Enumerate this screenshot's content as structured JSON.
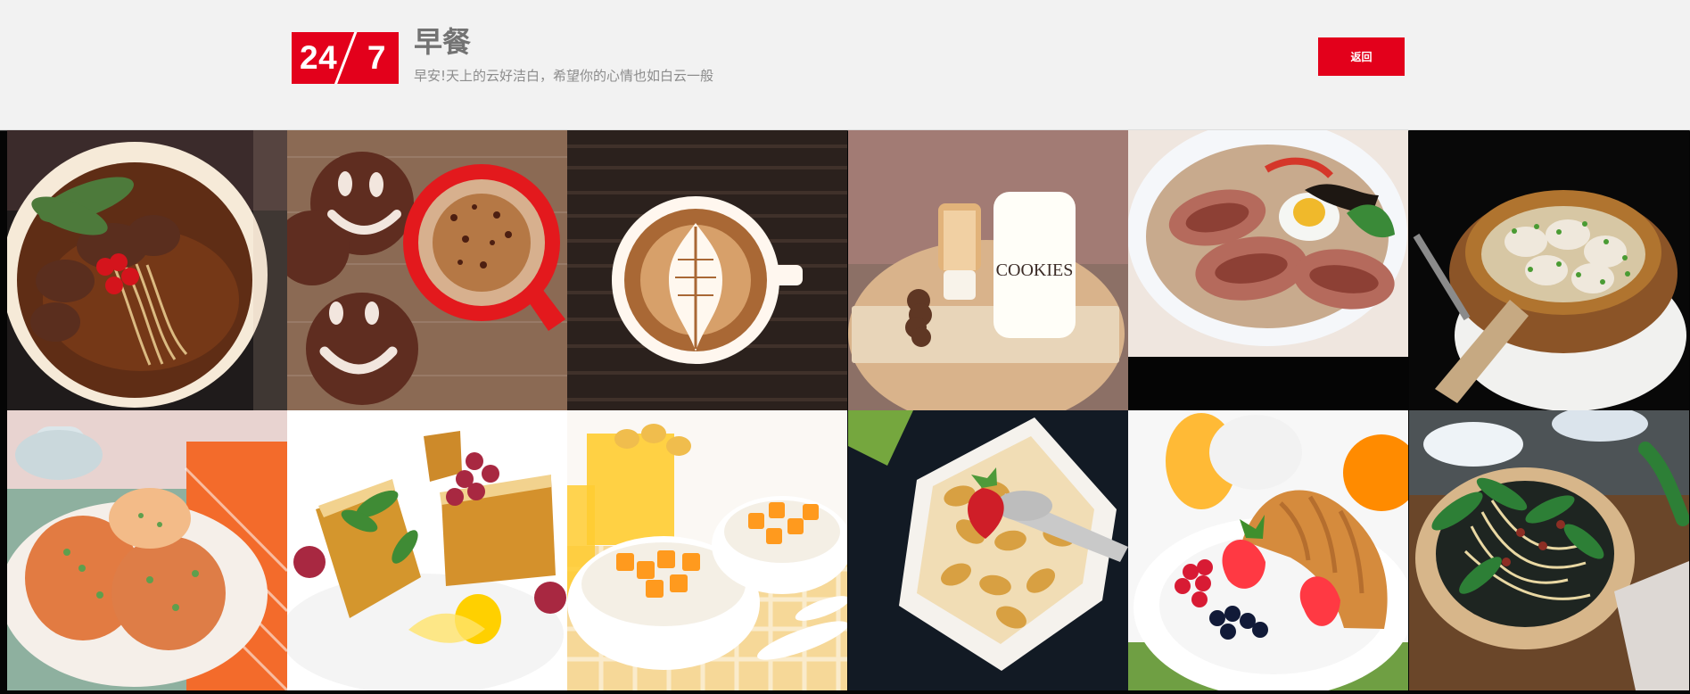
{
  "header": {
    "logo_left": "24",
    "logo_right": "7",
    "title": "早餐",
    "subtitle": "早安!天上的云好洁白，希望你的心情也如白云一般",
    "back_label": "返回"
  },
  "colors": {
    "accent": "#e3001b",
    "header_background": "#f2f2f2",
    "title_text": "#737373",
    "subtitle_text": "#8c8c8c"
  },
  "gallery": {
    "tiles": [
      {
        "image": "beef-noodle-soup"
      },
      {
        "image": "smiley-cookies-and-coffee"
      },
      {
        "image": "latte-art-coffee"
      },
      {
        "image": "milk-cookies-jar"
      },
      {
        "image": "ramen-bowl"
      },
      {
        "image": "dumpling-pot"
      },
      {
        "image": "savory-pancakes"
      },
      {
        "image": "french-toast"
      },
      {
        "image": "oatmeal-and-juice"
      },
      {
        "image": "cereal-with-milk"
      },
      {
        "image": "croissant-breakfast"
      },
      {
        "image": "noodle-salad"
      }
    ]
  }
}
